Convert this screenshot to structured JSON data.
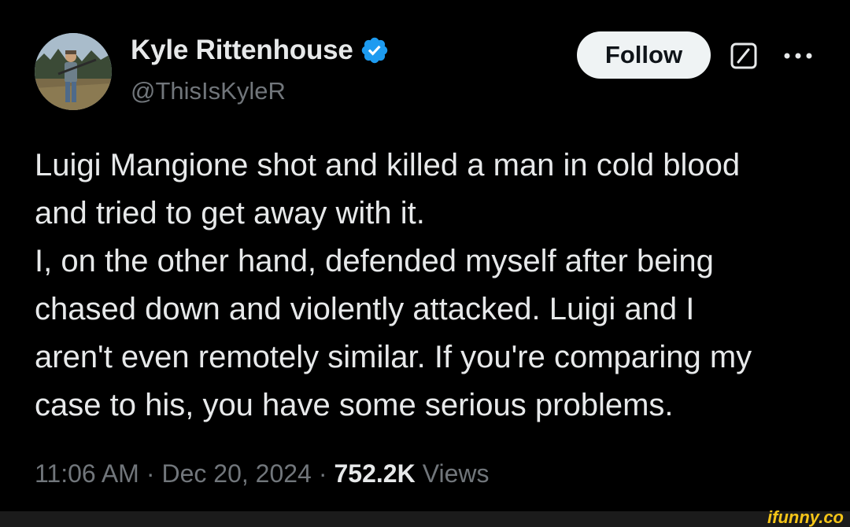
{
  "tweet": {
    "author": {
      "display_name": "Kyle Rittenhouse",
      "handle": "@ThisIsKyleR",
      "verified": true
    },
    "follow_label": "Follow",
    "text_lines": [
      "Luigi Mangione shot and killed a man in cold blood",
      "and tried to get away with it.",
      "I, on the other hand, defended myself after being",
      "chased down and violently attacked. Luigi and I",
      "aren't even remotely similar. If you're comparing my",
      "case to his, you have some serious problems."
    ],
    "time": "11:06 AM",
    "separator": "·",
    "date": "Dec 20, 2024",
    "views_count": "752.2K",
    "views_label": "Views"
  },
  "watermark": {
    "text": "ifunny.co"
  },
  "icons": {
    "verified": "verified-badge-icon",
    "grok": "grok-icon",
    "more": "more-icon"
  },
  "colors": {
    "background": "#000000",
    "text_primary": "#e7e9ea",
    "text_secondary": "#71767b",
    "verified_blue": "#1d9bf0",
    "follow_bg": "#eff3f4",
    "watermark": "#f5c518"
  }
}
